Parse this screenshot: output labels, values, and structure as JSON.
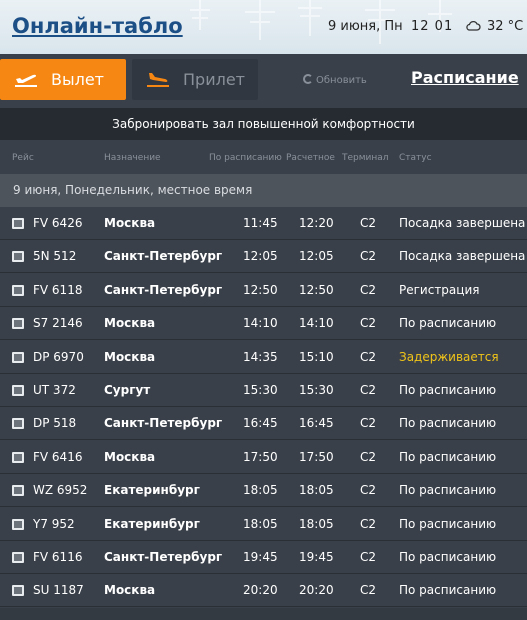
{
  "header": {
    "title": "Онлайн-табло",
    "date": "9 июня, Пн",
    "time": "12 01",
    "temperature": "32 °C"
  },
  "nav": {
    "departure_label": "Вылет",
    "arrival_label": "Прилет",
    "refresh_label": "Обновить",
    "schedule_label": "Расписание"
  },
  "banner": {
    "text": "Забронировать зал повышенной комфортности"
  },
  "columns": {
    "flight": "Рейс",
    "destination": "Назначение",
    "scheduled": "По расписанию",
    "estimated": "Расчетное",
    "terminal": "Терминал",
    "status": "Статус"
  },
  "day_header": "9 июня, Понедельник, местное время",
  "flights": [
    {
      "flight": "FV 6426",
      "destination": "Москва",
      "scheduled": "11:45",
      "estimated": "12:20",
      "terminal": "C2",
      "status": "Посадка завершена"
    },
    {
      "flight": "5N 512",
      "destination": "Санкт-Петербург",
      "scheduled": "12:05",
      "estimated": "12:05",
      "terminal": "C2",
      "status": "Посадка завершена"
    },
    {
      "flight": "FV 6118",
      "destination": "Санкт-Петербург",
      "scheduled": "12:50",
      "estimated": "12:50",
      "terminal": "C2",
      "status": "Регистрация"
    },
    {
      "flight": "S7 2146",
      "destination": "Москва",
      "scheduled": "14:10",
      "estimated": "14:10",
      "terminal": "C2",
      "status": "По расписанию"
    },
    {
      "flight": "DP 6970",
      "destination": "Москва",
      "scheduled": "14:35",
      "estimated": "15:10",
      "terminal": "C2",
      "status": "Задерживается"
    },
    {
      "flight": "UT 372",
      "destination": "Сургут",
      "scheduled": "15:30",
      "estimated": "15:30",
      "terminal": "C2",
      "status": "По расписанию"
    },
    {
      "flight": "DP 518",
      "destination": "Санкт-Петербург",
      "scheduled": "16:45",
      "estimated": "16:45",
      "terminal": "C2",
      "status": "По расписанию"
    },
    {
      "flight": "FV 6416",
      "destination": "Москва",
      "scheduled": "17:50",
      "estimated": "17:50",
      "terminal": "C2",
      "status": "По расписанию"
    },
    {
      "flight": "WZ 6952",
      "destination": "Екатеринбург",
      "scheduled": "18:05",
      "estimated": "18:05",
      "terminal": "C2",
      "status": "По расписанию"
    },
    {
      "flight": "Y7 952",
      "destination": "Екатеринбург",
      "scheduled": "18:05",
      "estimated": "18:05",
      "terminal": "C2",
      "status": "По расписанию"
    },
    {
      "flight": "FV 6116",
      "destination": "Санкт-Петербург",
      "scheduled": "19:45",
      "estimated": "19:45",
      "terminal": "C2",
      "status": "По расписанию"
    },
    {
      "flight": "SU 1187",
      "destination": "Москва",
      "scheduled": "20:20",
      "estimated": "20:20",
      "terminal": "C2",
      "status": "По расписанию"
    }
  ],
  "colors": {
    "accent": "#f68712",
    "delayed": "#f0c419",
    "title": "#1d4f87"
  }
}
